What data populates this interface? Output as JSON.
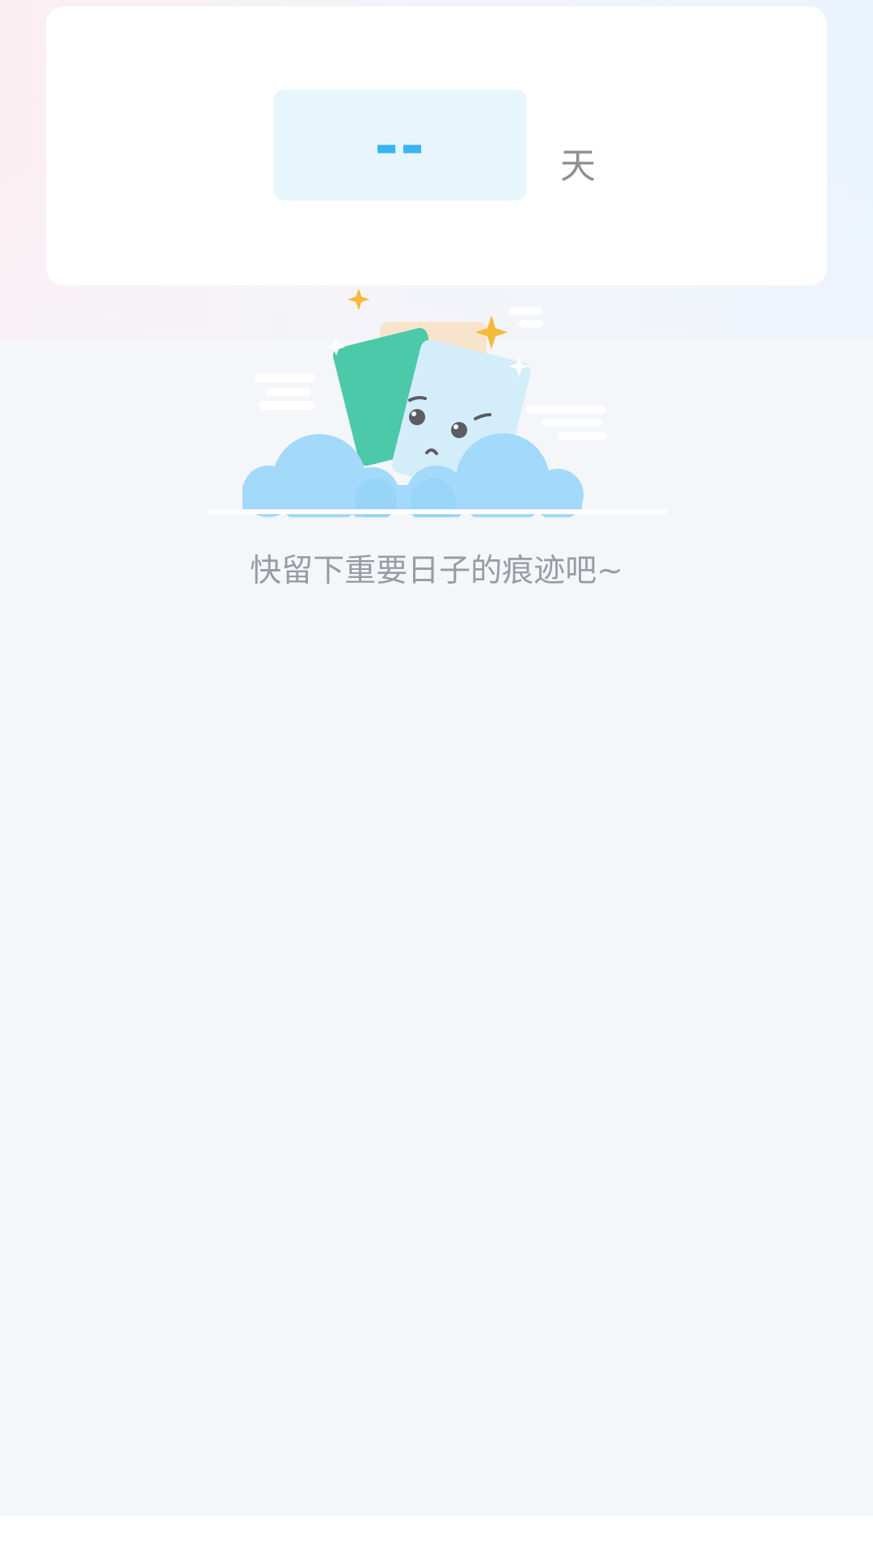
{
  "counter": {
    "days_value": "--",
    "days_unit": "天"
  },
  "empty_state": {
    "illustration_icon": "sad-cards-on-cloud-illustration",
    "message": "快留下重要日子的痕迹吧~"
  },
  "colors": {
    "accent": "#3ab4f2",
    "days_box_bg": "#e7f5fd",
    "card_bg": "#ffffff",
    "page_bg": "#f4f6fa",
    "muted_text": "#9a9ba3"
  }
}
